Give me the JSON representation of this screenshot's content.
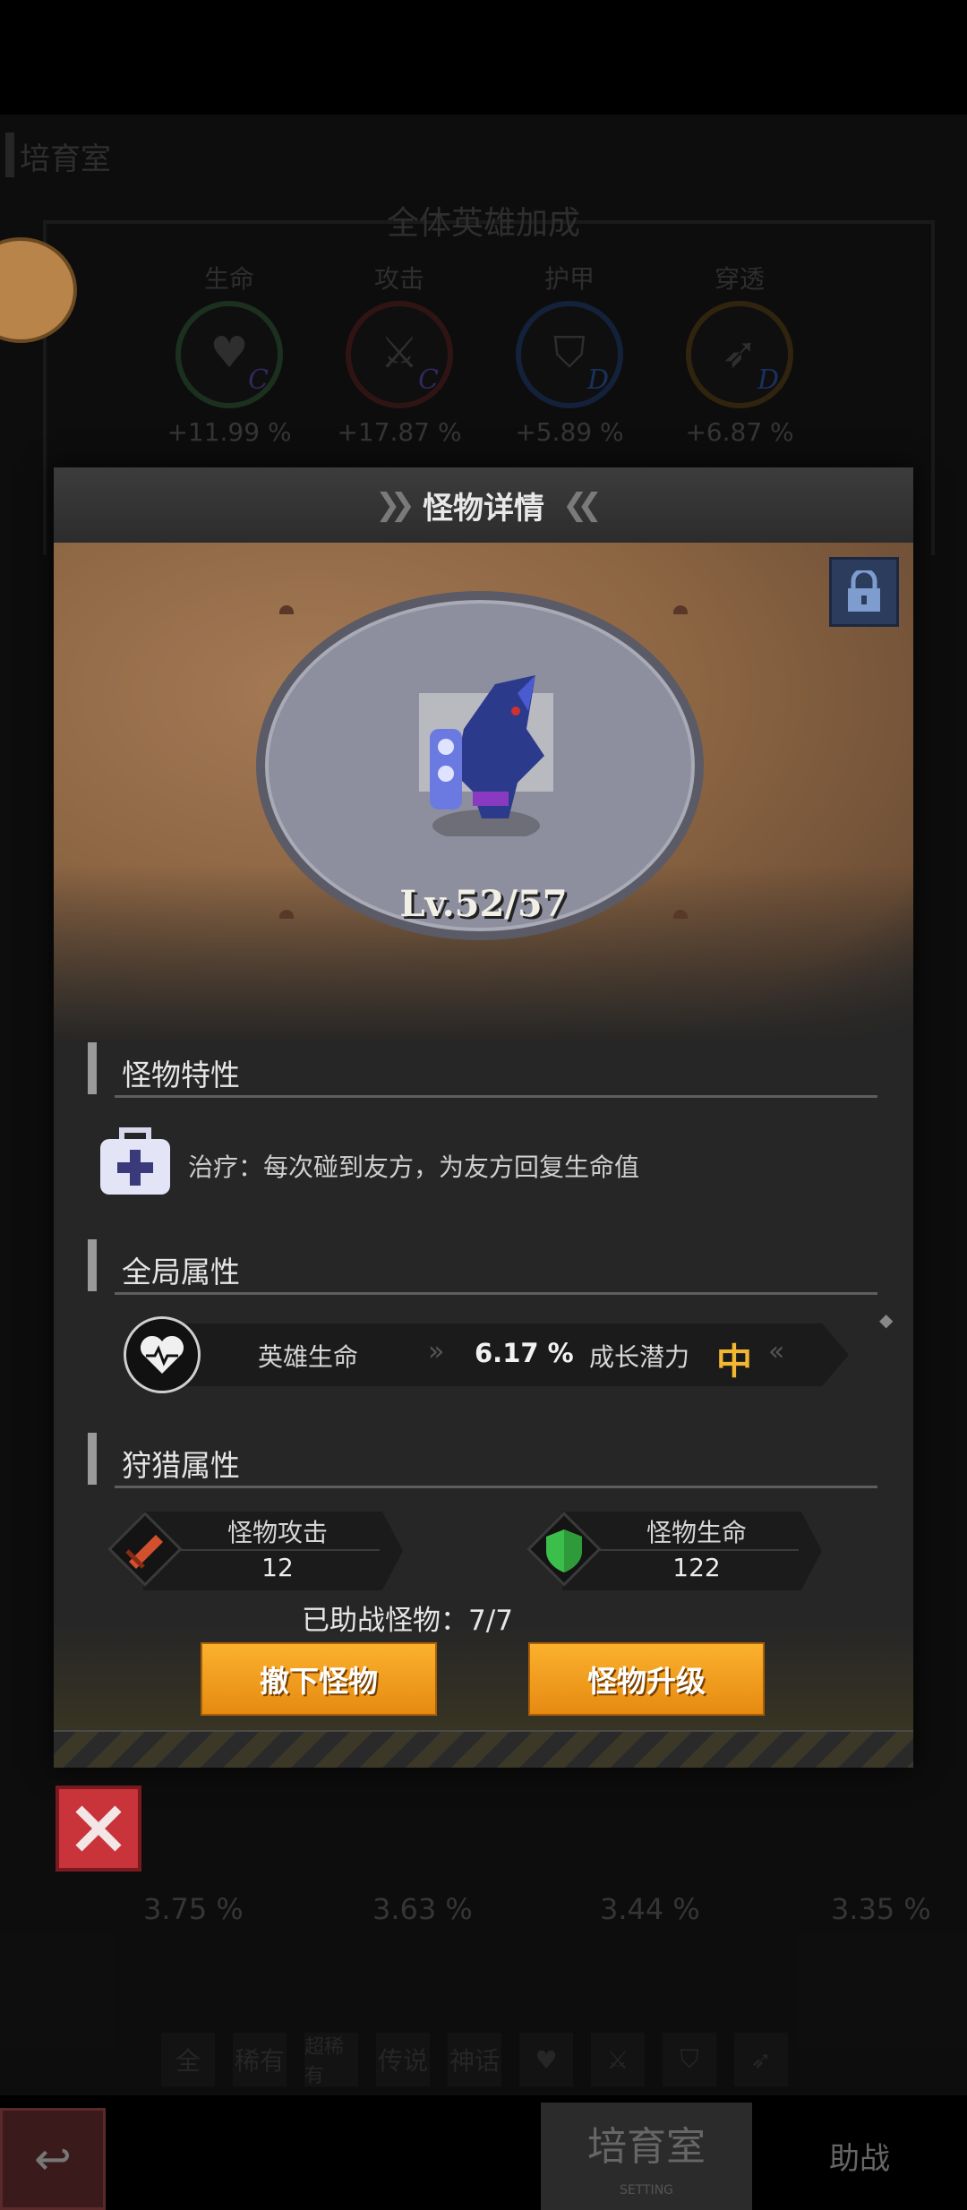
{
  "background": {
    "room_title": "培育室",
    "bonus_title": "全体英雄加成",
    "stats": [
      {
        "label": "生命",
        "value": "+11.99 %",
        "grade": "C",
        "icon": "heart-icon",
        "color": "#3d8a4a"
      },
      {
        "label": "攻击",
        "value": "+17.87 %",
        "grade": "C",
        "icon": "sword-icon",
        "color": "#a83a3a"
      },
      {
        "label": "护甲",
        "value": "+5.89 %",
        "grade": "D",
        "icon": "shield-icon",
        "color": "#2a5ab0"
      },
      {
        "label": "穿透",
        "value": "+6.87 %",
        "grade": "D",
        "icon": "pierce-icon",
        "color": "#b07a20"
      }
    ],
    "row_stats": [
      "3.75 %",
      "3.63 %",
      "3.44 %",
      "3.35 %"
    ],
    "filters": [
      "全",
      "稀有",
      "超稀有",
      "传说",
      "神话"
    ],
    "nav": {
      "active_tab": "培育室",
      "active_sub": "SETTING",
      "other_tab": "助战"
    }
  },
  "modal": {
    "title": "怪物详情",
    "level": "Lv.52/57",
    "trait_section": "怪物特性",
    "trait_text": "治疗：每次碰到友方，为友方回复生命值",
    "global_section": "全局属性",
    "global": {
      "label": "英雄生命",
      "value": "6.17 %",
      "potential_label": "成长潜力",
      "potential": "中"
    },
    "hunt_section": "狩猎属性",
    "hunt_attack": {
      "label": "怪物攻击",
      "value": "12"
    },
    "hunt_hp": {
      "label": "怪物生命",
      "value": "122"
    },
    "assist": "已助战怪物：7/7",
    "btn_remove": "撤下怪物",
    "btn_upgrade": "怪物升级"
  },
  "colors": {
    "accent": "#f5a623",
    "potential": "#f3b632",
    "close": "#c8343a",
    "lock": "#2c3c5c"
  }
}
